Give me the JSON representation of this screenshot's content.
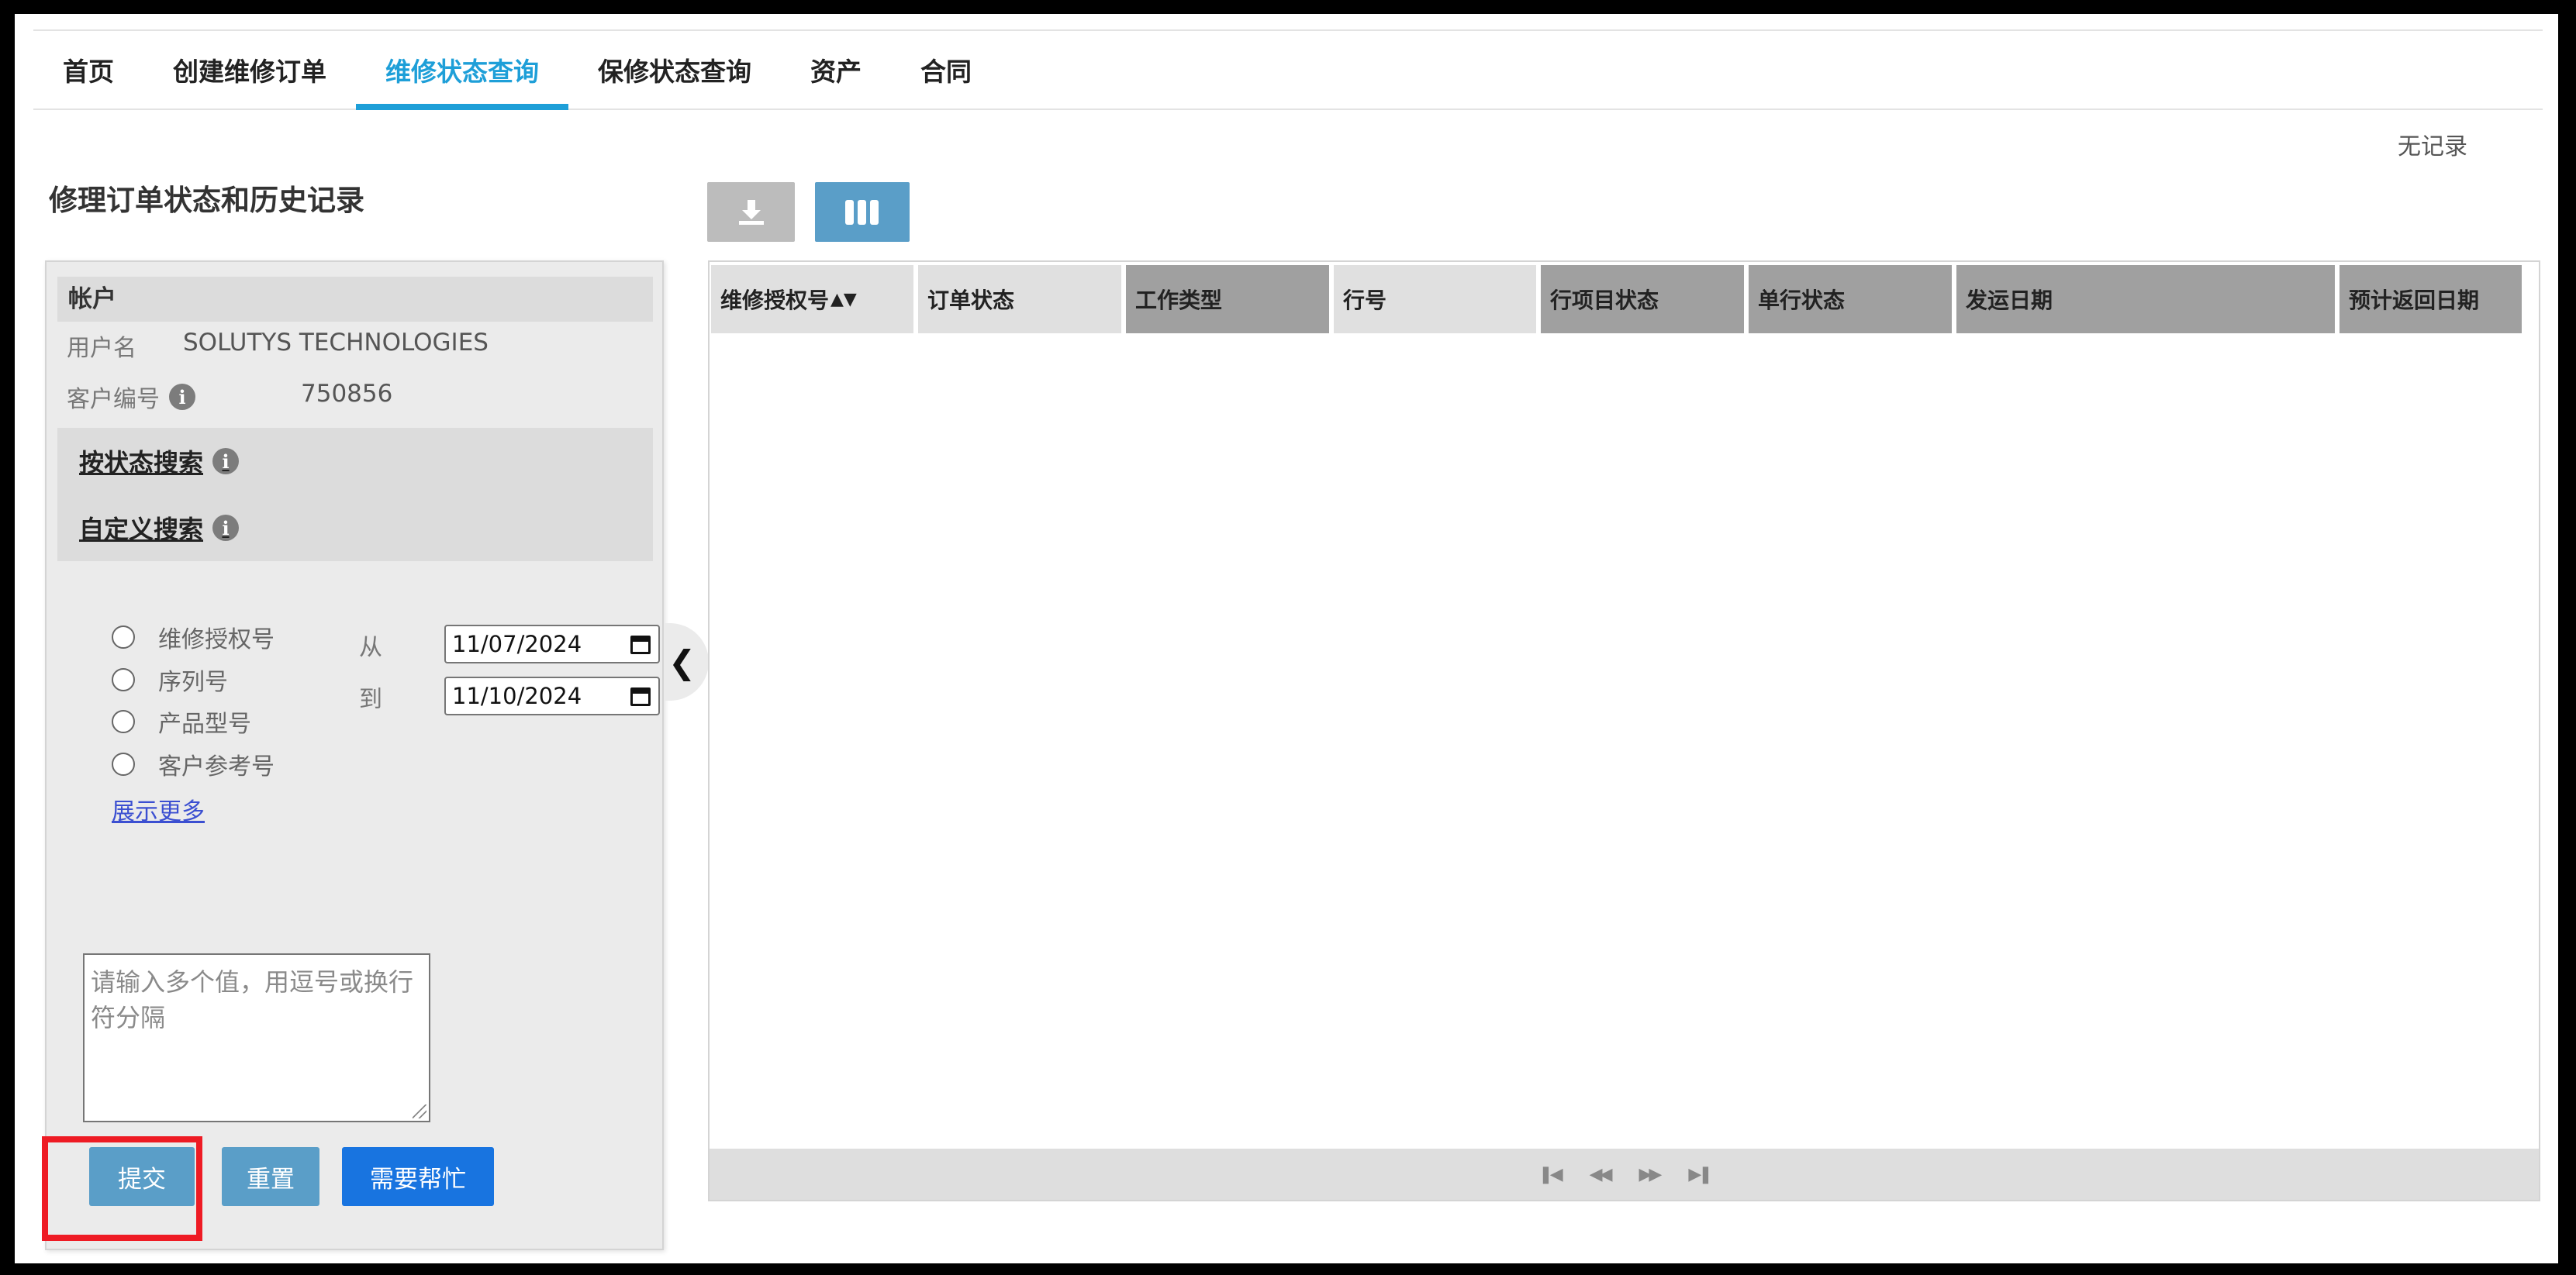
{
  "nav": {
    "tabs": [
      {
        "label": "首页"
      },
      {
        "label": "创建维修订单"
      },
      {
        "label": "维修状态查询",
        "active": true
      },
      {
        "label": "保修状态查询"
      },
      {
        "label": "资产"
      },
      {
        "label": "合同"
      }
    ]
  },
  "status": {
    "no_records": "无记录"
  },
  "page": {
    "title": "修理订单状态和历史记录"
  },
  "account": {
    "header": "帐户",
    "username_label": "用户名",
    "username_value": "SOLUTYS TECHNOLOGIES",
    "customer_no_label": "客户编号",
    "customer_no_value": "750856"
  },
  "search": {
    "by_status": "按状态搜索",
    "custom": "自定义搜索",
    "radio_options": [
      "维修授权号",
      "序列号",
      "产品型号",
      "客户参考号"
    ],
    "show_more": "展示更多",
    "from_label": "从",
    "to_label": "到",
    "from_date": "11/07/2024",
    "to_date": "11/10/2024",
    "multi_placeholder": "请输入多个值，用逗号或换行符分隔"
  },
  "buttons": {
    "submit": "提交",
    "reset": "重置",
    "help": "需要帮忙"
  },
  "grid": {
    "columns": [
      {
        "label": "维修授权号",
        "sort": "▲▼"
      },
      {
        "label": "订单状态"
      },
      {
        "label": "工作类型"
      },
      {
        "label": "行号"
      },
      {
        "label": "行项目状态"
      },
      {
        "label": "单行状态"
      },
      {
        "label": "发运日期"
      },
      {
        "label": "预计返回日期"
      }
    ]
  },
  "colors": {
    "accent": "#1e9fd8",
    "button": "#5a9ec8",
    "help_button": "#1874e0",
    "highlight": "#ee1b24"
  }
}
